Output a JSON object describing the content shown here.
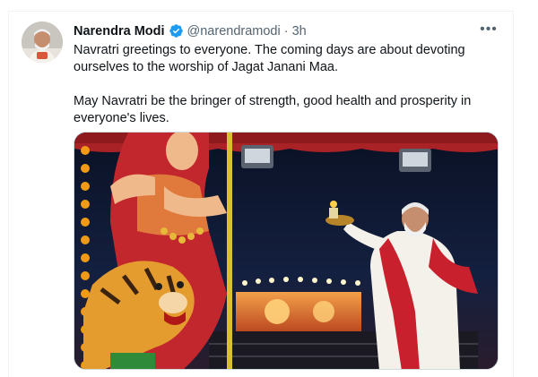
{
  "tweet": {
    "author_name": "Narendra Modi",
    "author_handle": "@narendramodi",
    "separator": "·",
    "timestamp": "3h",
    "more_glyph": "•••",
    "verified_icon": "verified-badge-icon",
    "paragraphs": [
      "Navratri greetings to everyone. The coming days are about devoting ourselves to the worship of Jagat Janani Maa.",
      "May Navratri be the bringer of strength, good health and prosperity in everyone's lives."
    ],
    "image": {
      "alt": "Photo of Narendra Modi performing aarti in front of a Durga idol with a tiger"
    }
  },
  "colors": {
    "text_primary": "#0f1419",
    "text_secondary": "#536471",
    "verified_blue": "#1d9bf0",
    "border": "#eff3f4"
  }
}
